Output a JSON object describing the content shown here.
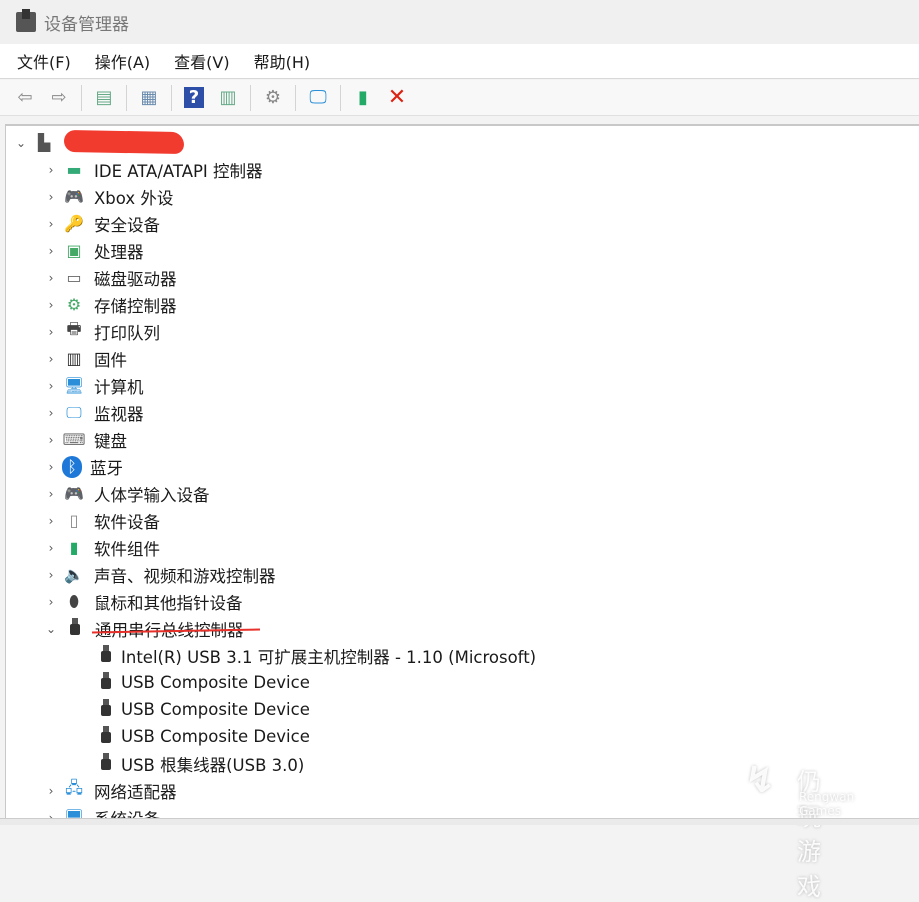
{
  "window": {
    "title": "设备管理器"
  },
  "menu": [
    "文件(F)",
    "操作(A)",
    "查看(V)",
    "帮助(H)"
  ],
  "toolbar": [
    {
      "icon": "back-arrow-icon",
      "glyph": "⇦",
      "color": "#888"
    },
    {
      "icon": "forward-arrow-icon",
      "glyph": "⇨",
      "color": "#888"
    },
    {
      "sep": true
    },
    {
      "icon": "show-hide-console-tree-icon",
      "glyph": "▤",
      "color": "#6a8"
    },
    {
      "sep": true
    },
    {
      "icon": "properties-icon",
      "glyph": "▦",
      "color": "#6b8cae"
    },
    {
      "sep": true
    },
    {
      "icon": "help-icon",
      "glyph": "?",
      "color": "#fff",
      "bg": "#2e4fa8"
    },
    {
      "icon": "action-pane-icon",
      "glyph": "▥",
      "color": "#6a8"
    },
    {
      "sep": true
    },
    {
      "icon": "update-driver-icon",
      "glyph": "⚙",
      "color": "#888"
    },
    {
      "sep": true
    },
    {
      "icon": "scan-hardware-icon",
      "glyph": "🖵",
      "color": "#2a8fd8"
    },
    {
      "sep": true
    },
    {
      "icon": "enable-device-icon",
      "glyph": "▮",
      "color": "#2a6"
    },
    {
      "icon": "uninstall-icon",
      "glyph": "✕",
      "color": "#d21"
    }
  ],
  "tree": {
    "root": {
      "expanded": true
    },
    "categories": [
      {
        "label": "IDE ATA/ATAPI 控制器",
        "icon": "ide-controller-icon",
        "glyph": "▬",
        "color": "#3a7"
      },
      {
        "label": "Xbox 外设",
        "icon": "gamepad-icon",
        "glyph": "🎮",
        "color": "#555"
      },
      {
        "label": "安全设备",
        "icon": "security-device-icon",
        "glyph": "🔑",
        "color": "#3a3"
      },
      {
        "label": "处理器",
        "icon": "processor-icon",
        "glyph": "▣",
        "color": "#4a6"
      },
      {
        "label": "磁盘驱动器",
        "icon": "disk-drive-icon",
        "glyph": "▭",
        "color": "#666"
      },
      {
        "label": "存储控制器",
        "icon": "storage-controller-icon",
        "glyph": "⚙",
        "color": "#4a6"
      },
      {
        "label": "打印队列",
        "icon": "printer-icon",
        "glyph": "🖶",
        "color": "#444"
      },
      {
        "label": "固件",
        "icon": "firmware-icon",
        "glyph": "▥",
        "color": "#333"
      },
      {
        "label": "计算机",
        "icon": "computer-icon",
        "glyph": "🖥",
        "color": "#2a8fd8"
      },
      {
        "label": "监视器",
        "icon": "monitor-icon",
        "glyph": "🖵",
        "color": "#2a8fd8"
      },
      {
        "label": "键盘",
        "icon": "keyboard-icon",
        "glyph": "⌨",
        "color": "#777"
      },
      {
        "label": "蓝牙",
        "icon": "bluetooth-icon",
        "glyph": "ᛒ",
        "color": "#fff",
        "bg": "#1e78d7"
      },
      {
        "label": "人体学输入设备",
        "icon": "hid-icon",
        "glyph": "🎮",
        "color": "#555"
      },
      {
        "label": "软件设备",
        "icon": "software-device-icon",
        "glyph": "▯",
        "color": "#888"
      },
      {
        "label": "软件组件",
        "icon": "software-component-icon",
        "glyph": "▮",
        "color": "#2a6"
      },
      {
        "label": "声音、视频和游戏控制器",
        "icon": "speaker-icon",
        "glyph": "🔈",
        "color": "#777"
      },
      {
        "label": "鼠标和其他指针设备",
        "icon": "mouse-icon",
        "glyph": "⬮",
        "color": "#444"
      },
      {
        "label": "通用串行总线控制器",
        "icon": "usb-icon",
        "expanded": true,
        "children": [
          "Intel(R) USB 3.1 可扩展主机控制器 - 1.10 (Microsoft)",
          "USB Composite Device",
          "USB Composite Device",
          "USB Composite Device",
          "USB 根集线器(USB 3.0)"
        ]
      },
      {
        "label": "网络适配器",
        "icon": "network-adapter-icon",
        "glyph": "🖧",
        "color": "#2a8fd8"
      },
      {
        "label": "系统设备",
        "icon": "system-device-icon",
        "glyph": "🖥",
        "color": "#2a8fd8"
      }
    ]
  },
  "watermark": {
    "cn": "仍玩游戏",
    "en": "Rengwan Games"
  }
}
